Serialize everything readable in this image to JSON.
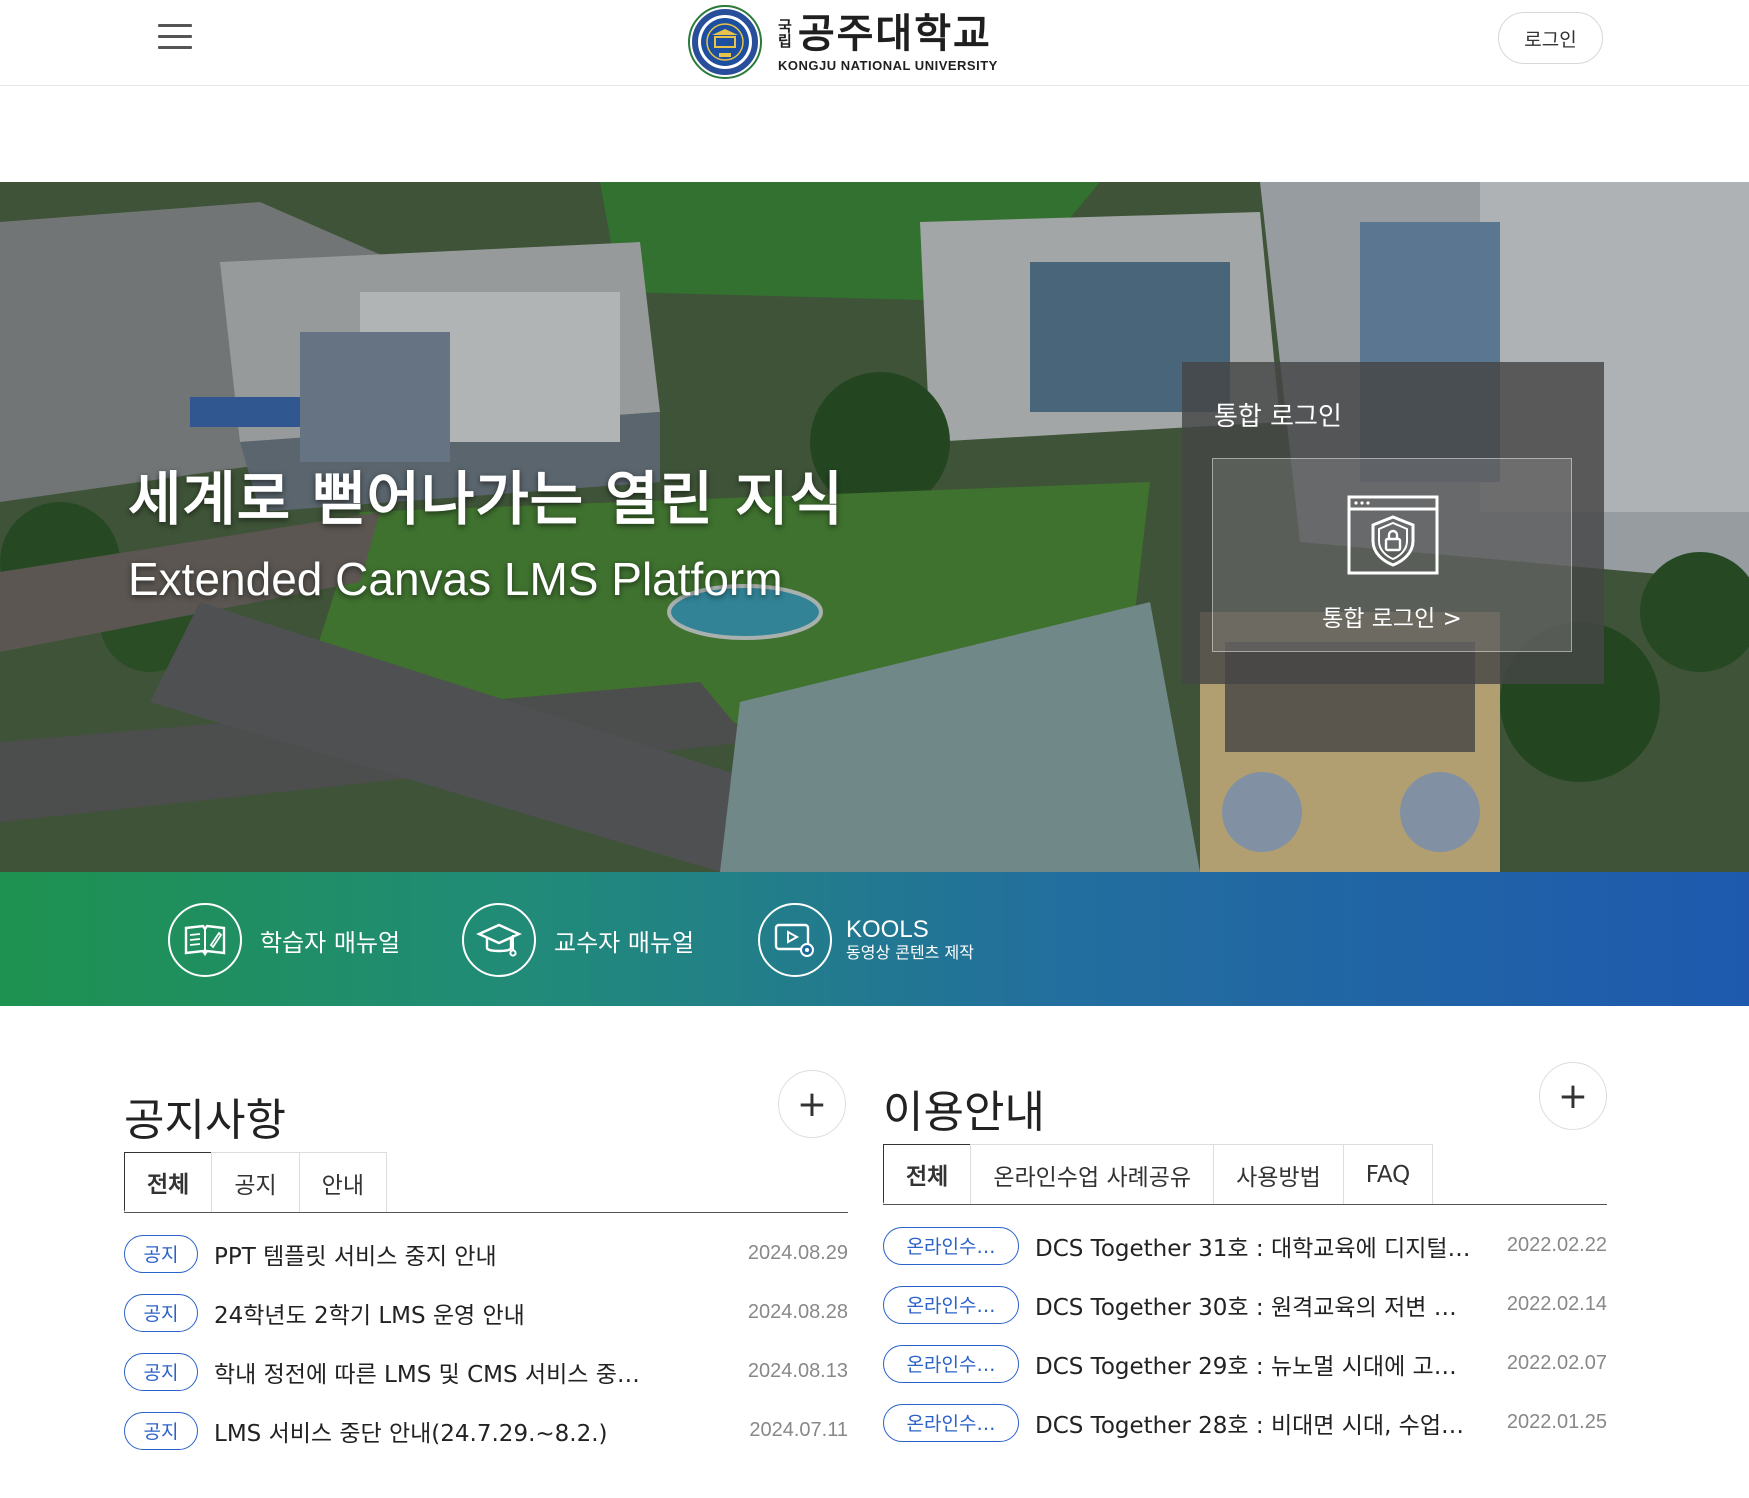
{
  "header": {
    "logo": {
      "prefix_top": "국",
      "prefix_bottom": "립",
      "name_ko": "공주대학교",
      "name_en": "KONGJU NATIONAL UNIVERSITY"
    },
    "login_label": "로그인"
  },
  "hero": {
    "title": "세계로 뻗어나가는 열린 지식",
    "subtitle": "Extended Canvas LMS Platform",
    "login_panel": {
      "title": "통합 로그인",
      "card_label": "통합 로그인 >"
    }
  },
  "quick_links": [
    {
      "label": "학습자 매뉴얼",
      "icon": "book-icon"
    },
    {
      "label": "교수자 매뉴얼",
      "icon": "graduation-cap-icon"
    },
    {
      "label": "KOOLS",
      "sublabel": "동영상 콘텐츠 제작",
      "icon": "video-settings-icon"
    }
  ],
  "notices": {
    "title": "공지사항",
    "more_label": "+",
    "tabs": [
      "전체",
      "공지",
      "안내"
    ],
    "active_tab": 0,
    "items": [
      {
        "badge": "공지",
        "title": "PPT 템플릿 서비스 중지 안내",
        "date": "2024.08.29"
      },
      {
        "badge": "공지",
        "title": "24학년도 2학기 LMS 운영 안내",
        "date": "2024.08.28"
      },
      {
        "badge": "공지",
        "title": "학내 정전에 따른 LMS 및 CMS 서비스 중…",
        "date": "2024.08.13"
      },
      {
        "badge": "공지",
        "title": "LMS 서비스 중단 안내(24.7.29.~8.2.)",
        "date": "2024.07.11"
      }
    ]
  },
  "guide": {
    "title": "이용안내",
    "more_label": "+",
    "tabs": [
      "전체",
      "온라인수업 사례공유",
      "사용방법",
      "FAQ"
    ],
    "active_tab": 0,
    "items": [
      {
        "badge": "온라인수…",
        "title": "DCS Together  31호 : 대학교육에 디지털…",
        "date": "2022.02.22"
      },
      {
        "badge": "온라인수…",
        "title": "DCS Together  30호 : 원격교육의 저변 …",
        "date": "2022.02.14"
      },
      {
        "badge": "온라인수…",
        "title": "DCS Together  29호 : 뉴노멀 시대에 고…",
        "date": "2022.02.07"
      },
      {
        "badge": "온라인수…",
        "title": "DCS Together  28호 : 비대면 시대, 수업…",
        "date": "2022.01.25"
      }
    ]
  },
  "colors": {
    "badge_blue": "#2b62c9",
    "quickbar_green": "#128c46",
    "quickbar_blue": "#1250aa"
  }
}
